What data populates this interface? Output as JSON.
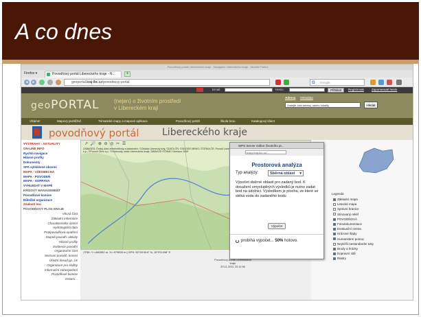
{
  "slide": {
    "title": "A co dnes",
    "colors": {
      "header": "#4a1606",
      "rule": "#c8a06a"
    }
  },
  "browser": {
    "window_title": "Povodňový portál Libereckého kraje - Navigační Libereckého kraje - Mozilla Firefox",
    "menu": "Firefox ▾",
    "tab_label": "Povodňový portál Libereckého kraje - N...",
    "newtab": "+",
    "url_prefix": "geoportal.",
    "url_domain": "kraj-lbc.cz",
    "url_path": "/povodnovy-portal",
    "search_placeholder": "Google",
    "nav_back": "◂",
    "nav_fwd": "▸"
  },
  "site_top": {
    "email_label": "Email:",
    "password_label": "Heslo:",
    "login_button": "Přihlásit",
    "register_link": "Registrovat",
    "forgot_link": "Zapomenuté heslo"
  },
  "banner": {
    "logo_geo": "geo",
    "logo_portal": "PORTAL",
    "tagline_1": "(nejen) o životním prostředí",
    "tagline_2": "v Libereckém kraji",
    "search_label_1": "Adresa",
    "search_label_2": "Metadata",
    "search_placeholder": "Zadejte část adresy, název lokality",
    "search_button": "Hledat"
  },
  "site_menu": [
    "Vítáme!",
    "Mapový prohlížeč",
    "Tématické mapy a mapové aplikace",
    "Povodňový portál",
    "Škola hrou",
    "Katalogový klient"
  ],
  "map_head": {
    "title": "povodňový portál",
    "subtitle": "Libereckého kraje"
  },
  "left_nav": [
    {
      "text": "VÝSTRAHY - AKTUALITY",
      "style": "red"
    },
    {
      "text": "ON-LINE INFO",
      "style": "red"
    },
    {
      "text": "Rychlá navigace",
      "style": "blue"
    },
    {
      "text": "Hlásné profily",
      "style": "blue"
    },
    {
      "text": "Dokumenty",
      "style": "blue"
    },
    {
      "text": "SPA vyhlášené obcemi",
      "style": "blue"
    },
    {
      "text": "MAPA - VŠEOBECNÁ",
      "style": "red"
    },
    {
      "text": "MAPA - POVODEŇ",
      "style": "blue"
    },
    {
      "text": "MAPA - SOPRAVA",
      "style": "blue"
    },
    {
      "text": "VYHLEDAT V MAPĚ",
      "style": "blue"
    },
    {
      "text": "KRIZOVÝ MANAGEMENT",
      "style": "gray"
    },
    {
      "text": "Povodňové komise",
      "style": "blue"
    },
    {
      "text": "Důležité organizace",
      "style": "blue"
    },
    {
      "text": "Znalostí lexi",
      "style": "red"
    },
    {
      "text": "POVODŇOVÝ PLÁN KRAJE",
      "style": "gray"
    },
    {
      "text": "Věcná část",
      "style": "it"
    },
    {
      "text": "Základní informace",
      "style": "it"
    },
    {
      "text": "Charakteristika území",
      "style": "it"
    },
    {
      "text": "Hydrologická data",
      "style": "it"
    },
    {
      "text": "Protipovodňová opatření",
      "style": "it"
    },
    {
      "text": "Stupně povodň. aktivity",
      "style": "it"
    },
    {
      "text": "Hlásné profily",
      "style": "it"
    },
    {
      "text": "Evidence povodní",
      "style": "it"
    },
    {
      "text": "Organizační část",
      "style": "it"
    },
    {
      "text": "Seznam povodň. komisí",
      "style": "it"
    },
    {
      "text": "Úřední dosud pp. LK",
      "style": "it"
    },
    {
      "text": "Organizace pro služby",
      "style": "it"
    },
    {
      "text": "Informační zabezpečení",
      "style": "it"
    },
    {
      "text": "Povodňové komise",
      "style": "it"
    },
    {
      "text": "Ostatní...",
      "style": "it"
    }
  ],
  "map": {
    "toolbar": "↗ 🔎 ⊕ ⊖ ◎ ✂ ☰",
    "info": "ZABAGED: Český úřad zeměměřický a katastrální; ©Ovládá Liberecký kraj; ©DATA ČR; ©GEODIS BRNO; ©CENIA ČR, Povodí Labe s.p.; ©Povodí Ohře s.p.; ©Vodovody, sídla Libereckého kraje, DIBAVOD ©ČHMÚ Olomouc 2009",
    "status": "JTSK: Y=-681552 m, X=-979525 m | GPS: 50°45'40.8\" N, 15°9'3.498\" E",
    "footer_line_1": "Povodňový portál Libereckého kraje",
    "footer_line_2": "29.11.2011 23:11:56"
  },
  "right_panel": {
    "legend_title": "Legenda",
    "layers": [
      {
        "name": "Základní mapa",
        "checked": true
      },
      {
        "name": "Letecké mapa",
        "checked": false
      },
      {
        "name": "Správní hranice",
        "checked": false
      },
      {
        "name": "Stínovaný reliéf",
        "checked": false
      },
      {
        "name": "POVODŇOVÁ",
        "checked": true
      },
      {
        "name": "Fotodokumentace",
        "checked": true
      },
      {
        "name": "Evakuační centra",
        "checked": true
      },
      {
        "name": "Hrázové šlaby",
        "checked": true
      },
      {
        "name": "Humanitární pomoc",
        "checked": true
      },
      {
        "name": "Nejnižší nestandardní toky",
        "checked": false
      },
      {
        "name": "Brody a hrázky",
        "checked": true
      },
      {
        "name": "Dopravní sítě",
        "checked": true
      },
      {
        "name": "Rastry",
        "checked": true
      }
    ]
  },
  "popup": {
    "window_title": "WPS Server Odbor životního pr...",
    "url": "mapy.kraj-lbc.cz/...",
    "title": "Prostorová analýza",
    "type_label": "Typ analýzy:",
    "type_value": "Sběrná oblast",
    "description": "Výpočet sběrné oblasti pro zadaný bod. K dosažení smysluplných výsledků je nutno zadat bod na údolnici. Výsledkem je plocha, ze které se stéká voda do zadaného bodu",
    "button": "Výpočet",
    "progress_prefix": "probíhá výpočet...",
    "progress_value": "50%",
    "progress_suffix": "hotovo."
  }
}
